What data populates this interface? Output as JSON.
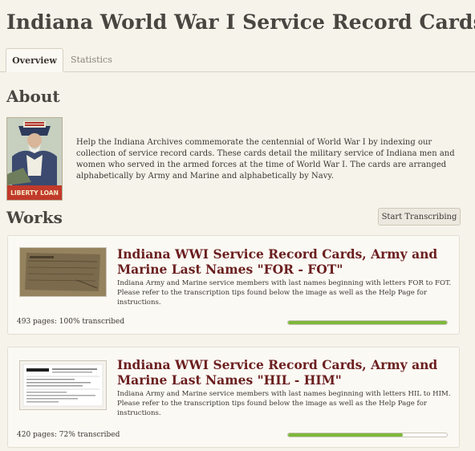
{
  "page": {
    "title": "Indiana World War I Service Record Cards"
  },
  "tabs": [
    {
      "label": "Overview",
      "active": true
    },
    {
      "label": "Statistics",
      "active": false
    }
  ],
  "about": {
    "heading": "About",
    "poster_caption": "LIBERTY LOAN",
    "text": "Help the Indiana Archives commemorate the centennial of World War I by indexing our collection of service record cards. These cards detail the military service of Indiana men and women who served in the armed forces at the time of World War I. The cards are arranged alphabetically by Army and Marine and alphabetically by Navy."
  },
  "works": {
    "heading": "Works",
    "start_button": "Start Transcribing",
    "items": [
      {
        "title": "Indiana WWI Service Record Cards, Army and Marine Last Names \"FOR - FOT\"",
        "description": "Indiana Army and Marine service members with last names beginning with letters FOR to FOT. Please refer to the transcription tips found below the image as well as the Help Page for instructions.",
        "pages_text": "493 pages: 100% transcribed",
        "progress": 1.0
      },
      {
        "title": "Indiana WWI Service Record Cards, Army and Marine Last Names \"HIL - HIM\"",
        "description": "Indiana Army and Marine service members with last names beginning with letters HIL to HIM. Please refer to the transcription tips found below the image as well as the Help Page for instructions.",
        "pages_text": "420 pages: 72% transcribed",
        "progress": 0.72
      }
    ]
  },
  "colors": {
    "background": "#f6f3ea",
    "work_title": "#6b1f1f",
    "progress": "#7db83a"
  }
}
